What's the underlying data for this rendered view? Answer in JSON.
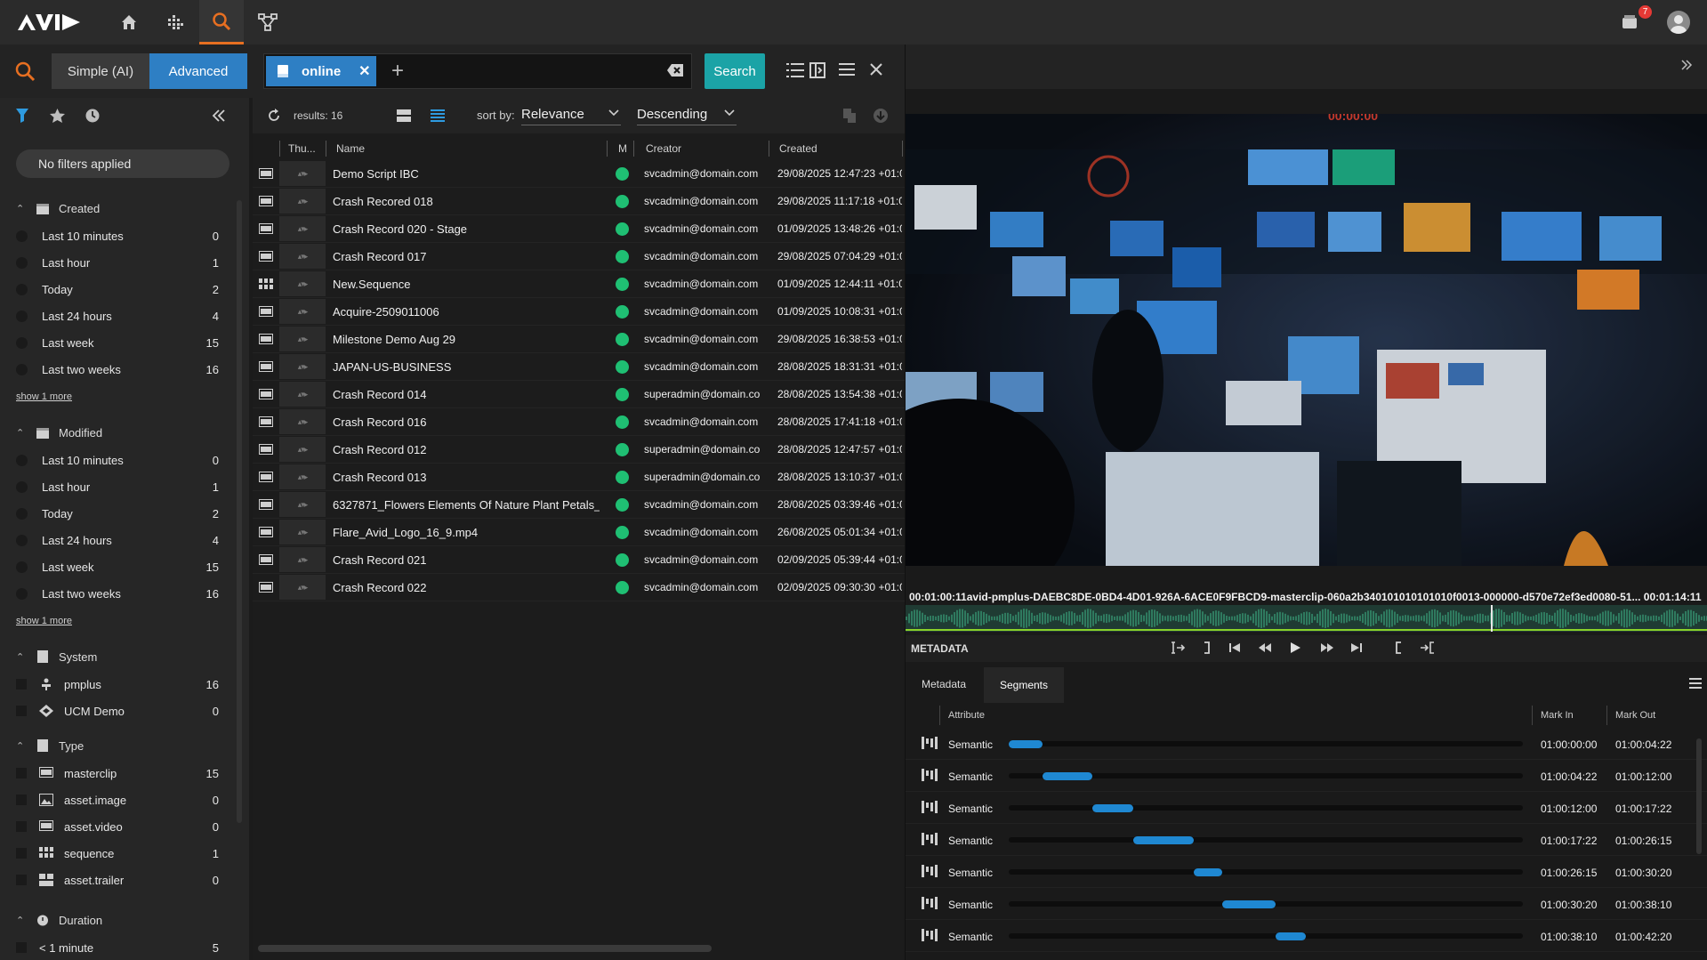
{
  "app": {
    "brand": "AVID"
  },
  "topbar": {
    "notifications_count": "7"
  },
  "search": {
    "mode_simple": "Simple (AI)",
    "mode_advanced": "Advanced",
    "chip_label": "online",
    "add_label": "+",
    "search_button": "Search"
  },
  "filters": {
    "summary": "No filters applied",
    "show_more": "show 1 more",
    "created": {
      "title": "Created",
      "items": [
        {
          "label": "Last 10 minutes",
          "count": "0"
        },
        {
          "label": "Last hour",
          "count": "1"
        },
        {
          "label": "Today",
          "count": "2"
        },
        {
          "label": "Last 24 hours",
          "count": "4"
        },
        {
          "label": "Last week",
          "count": "15"
        },
        {
          "label": "Last two weeks",
          "count": "16"
        }
      ]
    },
    "modified": {
      "title": "Modified",
      "items": [
        {
          "label": "Last 10 minutes",
          "count": "0"
        },
        {
          "label": "Last hour",
          "count": "1"
        },
        {
          "label": "Today",
          "count": "2"
        },
        {
          "label": "Last 24 hours",
          "count": "4"
        },
        {
          "label": "Last week",
          "count": "15"
        },
        {
          "label": "Last two weeks",
          "count": "16"
        }
      ]
    },
    "system": {
      "title": "System",
      "items": [
        {
          "label": "pmplus",
          "count": "16"
        },
        {
          "label": "UCM Demo",
          "count": "0"
        }
      ]
    },
    "type": {
      "title": "Type",
      "items": [
        {
          "label": "masterclip",
          "count": "15"
        },
        {
          "label": "asset.image",
          "count": "0"
        },
        {
          "label": "asset.video",
          "count": "0"
        },
        {
          "label": "sequence",
          "count": "1"
        },
        {
          "label": "asset.trailer",
          "count": "0"
        }
      ]
    },
    "duration": {
      "title": "Duration",
      "items": [
        {
          "label": "< 1 minute",
          "count": "5"
        }
      ]
    }
  },
  "results": {
    "count_label": "results: 16",
    "sort_label": "sort by:",
    "sort_value": "Relevance",
    "order_value": "Descending",
    "columns": {
      "thumb": "Thu...",
      "name": "Name",
      "media": "M",
      "creator": "Creator",
      "created": "Created"
    },
    "rows": [
      {
        "type": "masterclip",
        "name": "Demo Script IBC",
        "creator": "svcadmin@domain.com",
        "created": "29/08/2025 12:47:23 +01:0"
      },
      {
        "type": "masterclip",
        "name": "Crash Recored 018",
        "creator": "svcadmin@domain.com",
        "created": "29/08/2025 11:17:18 +01:0"
      },
      {
        "type": "masterclip",
        "name": "Crash Record 020 - Stage",
        "creator": "svcadmin@domain.com",
        "created": "01/09/2025 13:48:26 +01:0"
      },
      {
        "type": "masterclip",
        "name": "Crash Record 017",
        "creator": "svcadmin@domain.com",
        "created": "29/08/2025 07:04:29 +01:0"
      },
      {
        "type": "sequence",
        "name": "New.Sequence",
        "creator": "svcadmin@domain.com",
        "created": "01/09/2025 12:44:11 +01:0"
      },
      {
        "type": "masterclip",
        "name": "Acquire-2509011006",
        "creator": "svcadmin@domain.com",
        "created": "01/09/2025 10:08:31 +01:0"
      },
      {
        "type": "masterclip",
        "name": "Milestone Demo Aug 29",
        "creator": "svcadmin@domain.com",
        "created": "29/08/2025 16:38:53 +01:0"
      },
      {
        "type": "masterclip",
        "name": "JAPAN-US-BUSINESS",
        "creator": "svcadmin@domain.com",
        "created": "28/08/2025 18:31:31 +01:0"
      },
      {
        "type": "masterclip",
        "name": "Crash Record 014",
        "creator": "superadmin@domain.com",
        "created": "28/08/2025 13:54:38 +01:0"
      },
      {
        "type": "masterclip",
        "name": "Crash Record 016",
        "creator": "svcadmin@domain.com",
        "created": "28/08/2025 17:41:18 +01:0"
      },
      {
        "type": "masterclip",
        "name": "Crash Record 012",
        "creator": "superadmin@domain.com",
        "created": "28/08/2025 12:47:57 +01:0"
      },
      {
        "type": "masterclip",
        "name": "Crash Record 013",
        "creator": "superadmin@domain.com",
        "created": "28/08/2025 13:10:37 +01:0"
      },
      {
        "type": "masterclip",
        "name": "6327871_Flowers Elements Of Nature Plant Petals_...",
        "creator": "svcadmin@domain.com",
        "created": "28/08/2025 03:39:46 +01:0"
      },
      {
        "type": "masterclip",
        "name": "Flare_Avid_Logo_16_9.mp4",
        "creator": "svcadmin@domain.com",
        "created": "26/08/2025 05:01:34 +01:0"
      },
      {
        "type": "masterclip",
        "name": "Crash Record 021",
        "creator": "svcadmin@domain.com",
        "created": "02/09/2025 05:39:44 +01:0"
      },
      {
        "type": "masterclip",
        "name": "Crash Record 022",
        "creator": "svcadmin@domain.com",
        "created": "02/09/2025 09:30:30 +01:0"
      }
    ]
  },
  "player": {
    "clip_title": "00:01:00:11avid-pmplus-DAEBC8DE-0BD4-4D01-926A-6ACE0F9FBCD9-masterclip-060a2b340101010101010f0013-000000-d570e72ef3ed0080-51... 00:01:14:11",
    "overlay_timecode": "00:00:00",
    "playhead_fraction": 0.73,
    "metadata_label": "METADATA",
    "tab_metadata": "Metadata",
    "tab_segments": "Segments",
    "segment_columns": {
      "attribute": "Attribute",
      "mark_in": "Mark In",
      "mark_out": "Mark Out"
    },
    "segments": [
      {
        "attribute": "Semantic",
        "mark_in": "01:00:00:00",
        "mark_out": "01:00:04:22",
        "start": 0.0,
        "end": 0.066
      },
      {
        "attribute": "Semantic",
        "mark_in": "01:00:04:22",
        "mark_out": "01:00:12:00",
        "start": 0.066,
        "end": 0.162
      },
      {
        "attribute": "Semantic",
        "mark_in": "01:00:12:00",
        "mark_out": "01:00:17:22",
        "start": 0.162,
        "end": 0.242
      },
      {
        "attribute": "Semantic",
        "mark_in": "01:00:17:22",
        "mark_out": "01:00:26:15",
        "start": 0.242,
        "end": 0.359
      },
      {
        "attribute": "Semantic",
        "mark_in": "01:00:26:15",
        "mark_out": "01:00:30:20",
        "start": 0.359,
        "end": 0.416
      },
      {
        "attribute": "Semantic",
        "mark_in": "01:00:30:20",
        "mark_out": "01:00:38:10",
        "start": 0.416,
        "end": 0.519
      },
      {
        "attribute": "Semantic",
        "mark_in": "01:00:38:10",
        "mark_out": "01:00:42:20",
        "start": 0.519,
        "end": 0.578
      }
    ]
  },
  "colors": {
    "accent_blue": "#2e7fc4",
    "search_teal": "#1ba3a6",
    "online_green": "#1fbf73",
    "brand_orange": "#e76f21",
    "segment_blue": "#1f88d2"
  }
}
